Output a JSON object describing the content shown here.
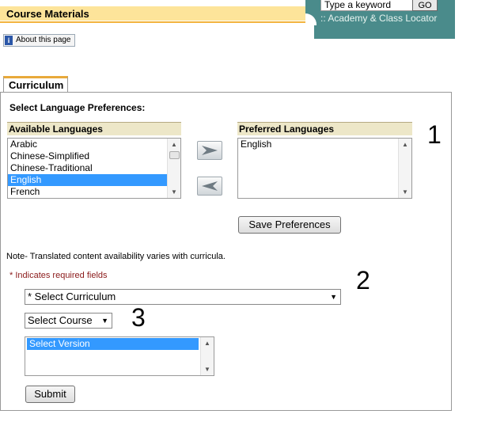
{
  "header": {
    "title": "Course Materials",
    "search_placeholder": "Type a keyword",
    "go_label": "GO",
    "academy_link": ":: Academy & Class Locator",
    "about_label": "About this page",
    "about_icon": "info-icon"
  },
  "tab": {
    "label": "Curriculum"
  },
  "language": {
    "section_title": "Select Language Preferences:",
    "available_header": "Available Languages",
    "available": [
      {
        "label": "Arabic",
        "selected": false
      },
      {
        "label": "Chinese-Simplified",
        "selected": false
      },
      {
        "label": "Chinese-Traditional",
        "selected": false
      },
      {
        "label": "English",
        "selected": true
      },
      {
        "label": "French",
        "selected": false
      }
    ],
    "preferred_header": "Preferred Languages",
    "preferred": [
      {
        "label": "English",
        "selected": false
      }
    ],
    "add_icon": "arrow-right-icon",
    "remove_icon": "arrow-left-icon",
    "save_label": "Save Preferences"
  },
  "note": "Note- Translated content availability varies with curricula.",
  "required_note": "* Indicates required fields",
  "form": {
    "curriculum_select": "* Select Curriculum",
    "course_select": "Select Course",
    "version_items": [
      {
        "label": "Select Version",
        "selected": true
      }
    ],
    "submit_label": "Submit"
  },
  "callouts": {
    "one": "1",
    "two": "2",
    "three": "3"
  },
  "colors": {
    "title_bg": "#fde49a",
    "title_line": "#f3b33d",
    "teal": "#4a8b8b",
    "header_bg": "#ede7c8",
    "selection": "#3399ff",
    "required": "#8b1a1a"
  }
}
